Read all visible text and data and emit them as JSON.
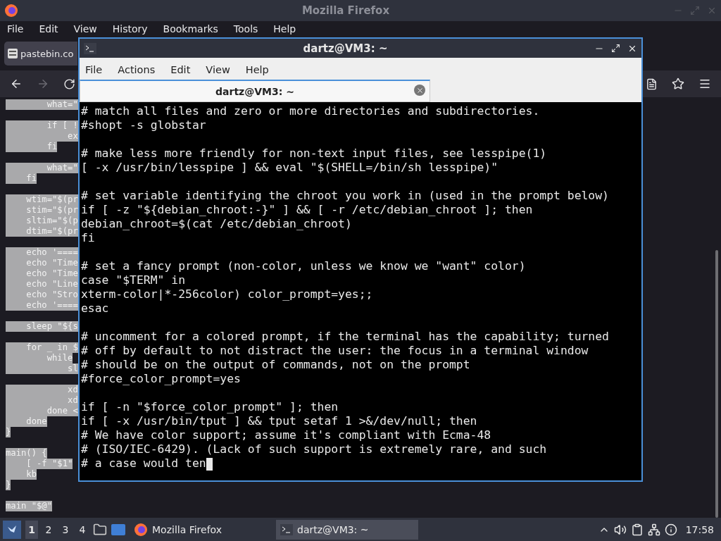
{
  "browser": {
    "title": "Mozilla Firefox",
    "menu": [
      "File",
      "Edit",
      "View",
      "History",
      "Bookmarks",
      "Tools",
      "Help"
    ],
    "tab": {
      "label": "pastebin.co",
      "selected": true
    },
    "nav": {
      "back_disabled": false,
      "forward_disabled": true
    },
    "page_blocks": [
      [
        "        what=\""
      ],
      [
        "        if [ !",
        "            ex",
        "        fi"
      ],
      [
        "        what=\"",
        "    fi"
      ],
      [
        "    wtim=\"$(pr",
        "    stim=\"$(pr",
        "    sltim=\"$(p",
        "    dtim=\"$(pr"
      ],
      [
        "    echo '====",
        "    echo \"Time",
        "    echo \"Time",
        "    echo \"Line",
        "    echo \"Stro",
        "    echo '===="
      ],
      [
        "    sleep \"${s"
      ],
      [
        "    for _ in $",
        "        while",
        "            sl"
      ],
      [
        "            xd",
        "            xd",
        "        done <",
        "    done",
        "}"
      ],
      [
        "main() {",
        "    [ -f \"$1\"",
        "    kb",
        "}"
      ],
      [
        "main \"$@\""
      ]
    ]
  },
  "terminal": {
    "title": "dartz@VM3: ~",
    "menu": [
      "File",
      "Actions",
      "Edit",
      "View",
      "Help"
    ],
    "tab": {
      "label": "dartz@VM3: ~",
      "selected": true
    },
    "blocks": [
      [
        "# match all files and zero or more directories and subdirectories.",
        "#shopt -s globstar"
      ],
      [
        "# make less more friendly for non-text input files, see lesspipe(1)",
        "[ -x /usr/bin/lesspipe ] && eval \"$(SHELL=/bin/sh lesspipe)\""
      ],
      [
        "# set variable identifying the chroot you work in (used in the prompt below)",
        "if [ -z \"${debian_chroot:-}\" ] && [ -r /etc/debian_chroot ]; then",
        "debian_chroot=$(cat /etc/debian_chroot)",
        "fi"
      ],
      [
        "# set a fancy prompt (non-color, unless we know we \"want\" color)",
        "case \"$TERM\" in",
        "xterm-color|*-256color) color_prompt=yes;;",
        "esac"
      ],
      [
        "# uncomment for a colored prompt, if the terminal has the capability; turned",
        "# off by default to not distract the user: the focus in a terminal window",
        "# should be on the output of commands, not on the prompt",
        "#force_color_prompt=yes"
      ],
      [
        "if [ -n \"$force_color_prompt\" ]; then",
        "if [ -x /usr/bin/tput ] && tput setaf 1 >&/dev/null; then",
        "# We have color support; assume it's compliant with Ecma-48",
        "# (ISO/IEC-6429). (Lack of such support is extremely rare, and such",
        "# a case would ten"
      ]
    ]
  },
  "taskbar": {
    "workspaces": [
      {
        "label": "1",
        "selected": true
      },
      {
        "label": "2",
        "selected": false
      },
      {
        "label": "3",
        "selected": false
      },
      {
        "label": "4",
        "selected": false
      }
    ],
    "tasks": [
      {
        "label": "Mozilla Firefox",
        "kind": "firefox",
        "selected": false
      },
      {
        "label": "dartz@VM3: ~",
        "kind": "terminal",
        "selected": true
      }
    ],
    "clock": "17:58"
  }
}
